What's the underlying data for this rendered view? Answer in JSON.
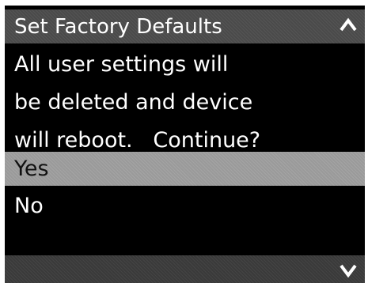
{
  "dialog": {
    "title": "Set Factory Defaults",
    "message_lines": [
      "All user settings will",
      "be deleted and device",
      "will reboot.   Continue?"
    ],
    "options": [
      {
        "label": "Yes",
        "selected": true
      },
      {
        "label": "No",
        "selected": false
      }
    ]
  },
  "icons": {
    "scroll_up": "chevron-up-icon",
    "scroll_down": "chevron-down-icon"
  },
  "colors": {
    "background": "#000000",
    "text": "#ffffff",
    "header_bar": "#4a4a4a",
    "selected_row": "#9a9a9a",
    "selected_text": "#111111"
  }
}
